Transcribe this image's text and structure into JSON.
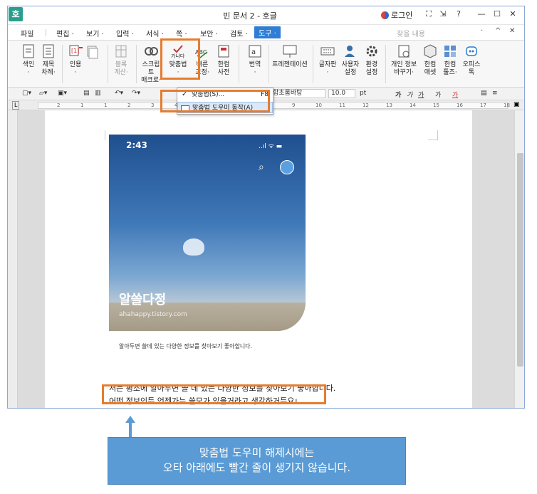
{
  "window": {
    "title": "빈 문서 2 - 호글",
    "app_icon": "호",
    "login_label": "로그인",
    "buttons": [
      "⛶",
      "⇲",
      "?",
      "—",
      "☐",
      "✕"
    ]
  },
  "menubar": {
    "items": [
      "파일",
      "편집 ·",
      "보기 ·",
      "입력 ·",
      "서식 ·",
      "쪽 ·",
      "보안 ·",
      "검토 ·"
    ],
    "active_item": "도구 ·",
    "search_placeholder": "찾을 내용",
    "right_buttons": [
      "·",
      "^",
      "✕"
    ]
  },
  "ribbon": {
    "buttons": [
      {
        "label": "색인",
        "sub": "·",
        "icon": "index-icon"
      },
      {
        "label": "제목",
        "sub": "차례·",
        "icon": "toc-icon"
      },
      {
        "label": "인용",
        "sub": "·",
        "icon": "citation-icon"
      },
      {
        "label": "블록",
        "sub": "계산·",
        "icon": "block-calc-icon",
        "disabled": true
      },
      {
        "label": "스크립트",
        "sub": "매크로·",
        "icon": "macro-icon"
      },
      {
        "label": "맞춤법",
        "sub": "·",
        "icon": "spellcheck-icon",
        "active": true
      },
      {
        "label": "빠른",
        "sub": "교정·",
        "icon": "quick-correct-icon"
      },
      {
        "label": "한컴",
        "sub": "사전",
        "icon": "dictionary-icon"
      },
      {
        "label": "번역",
        "sub": "·",
        "icon": "translate-icon"
      },
      {
        "label": "프레젠테이션",
        "sub": "",
        "icon": "presentation-icon"
      },
      {
        "label": "글자판",
        "sub": "·",
        "icon": "keyboard-icon"
      },
      {
        "label": "사용자",
        "sub": "설정",
        "icon": "user-settings-icon"
      },
      {
        "label": "환경",
        "sub": "설정",
        "icon": "gear-icon"
      },
      {
        "label": "개인 정보",
        "sub": "바꾸기·",
        "icon": "privacy-icon"
      },
      {
        "label": "한컴",
        "sub": "애셋",
        "icon": "asset-icon"
      },
      {
        "label": "한컴",
        "sub": "툴즈·",
        "icon": "tools-icon"
      },
      {
        "label": "오피스",
        "sub": "톡",
        "icon": "office-talk-icon"
      }
    ],
    "spellcheck_icon_text": "가나다",
    "abc_icon_text": "ABC"
  },
  "format_bar": {
    "font_name": "함초롬바탕",
    "font_size": "10.0",
    "font_unit": "pt",
    "style_glyphs": [
      "가",
      "가",
      "가",
      "가",
      "가"
    ]
  },
  "ruler": {
    "ticks": [
      "2",
      "1",
      "1",
      "2",
      "3",
      "4",
      "5",
      "6",
      "7",
      "8",
      "9",
      "10",
      "11",
      "12",
      "13",
      "14",
      "15",
      "16",
      "17",
      "18"
    ]
  },
  "dropdown": {
    "items": [
      {
        "label": "맞춤법(S)...",
        "shortcut": "F8",
        "checked": true
      },
      {
        "label": "맞춤법 도우미 동작(A)",
        "shortcut": "",
        "highlighted": true
      }
    ]
  },
  "document": {
    "screenshot": {
      "time": "2:43",
      "status": "..ıl ᯤ ▬",
      "blog_title": "알쓸다정",
      "blog_url": "ahahappy.tistory.com",
      "blog_desc": "알아두면 쓸데 있는 다양한 정보를 찾아보기 좋아합니다."
    },
    "line1": "저는 평소에 알아두면 쓸 데 있는 다양한 정보를 찾아보기 좋아합니다.",
    "line2": "어떤 정보인든 언젠가는 쓸모가 있을거라고 생각하거든요ㄴ."
  },
  "callout": {
    "line1": "맞춤법 도우미 해제시에는",
    "line2": "오타 아래에도 빨간 줄이 생기지 않습니다."
  },
  "colors": {
    "highlight_box": "#e67c2e",
    "callout_bg": "#5b9bd5",
    "active_menu": "#2e7ed6"
  }
}
